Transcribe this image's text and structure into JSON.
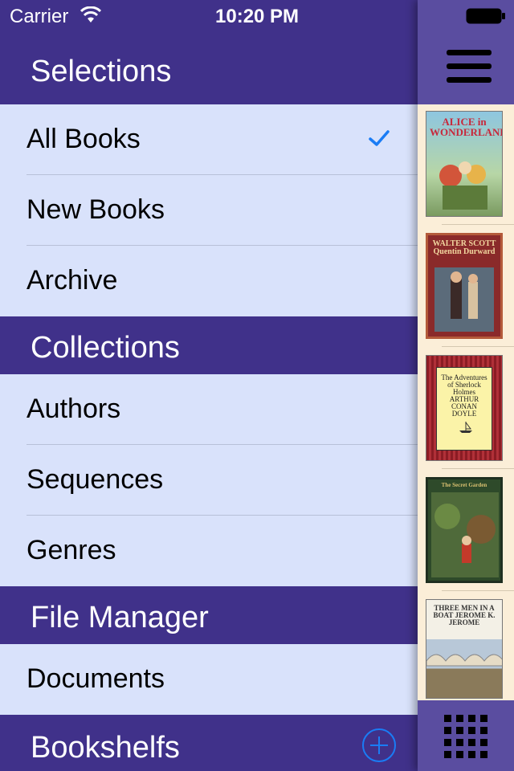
{
  "status": {
    "carrier": "Carrier",
    "time": "10:20 PM"
  },
  "sections": {
    "selections": "Selections",
    "collections": "Collections",
    "file_manager": "File Manager",
    "bookshelfs": "Bookshelfs"
  },
  "items": {
    "all_books": "All Books",
    "new_books": "New Books",
    "archive": "Archive",
    "authors": "Authors",
    "sequences": "Sequences",
    "genres": "Genres",
    "documents": "Documents"
  },
  "selected_item": "All Books",
  "covers": [
    {
      "title": "ALICE in WONDERLAND",
      "icon": "book-cover-alice"
    },
    {
      "title": "WALTER SCOTT Quentin Durward",
      "icon": "book-cover-quentin-durward"
    },
    {
      "title": "The Adventures of Sherlock Holmes ARTHUR CONAN DOYLE",
      "icon": "book-cover-sherlock-holmes"
    },
    {
      "title": "The Secret Garden",
      "icon": "book-cover-garden"
    },
    {
      "title": "THREE MEN IN A BOAT JEROME K. JEROME",
      "icon": "book-cover-three-men"
    }
  ],
  "colors": {
    "header": "#40318a",
    "strip_bar": "#5a4da0",
    "row_bg": "#d9e2fb",
    "accent": "#1a7cf5",
    "strip_bg": "#fbeed8"
  }
}
